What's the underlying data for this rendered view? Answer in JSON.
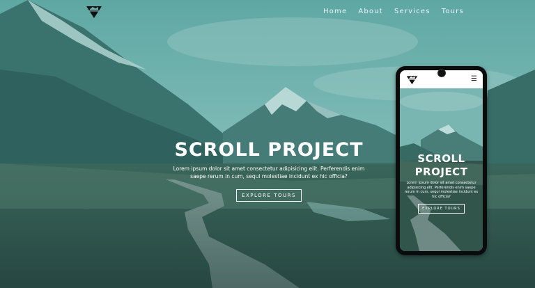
{
  "nav": {
    "logo_icon": "mountain-logo-icon",
    "links": [
      "Home",
      "About",
      "Services",
      "Tours"
    ]
  },
  "hero": {
    "title": "SCROLL PROJECT",
    "text": "Lorem ipsum dolor sit amet consectetur adipisicing elit. Perferendis enim saepe rerum in cum, sequi molestiae incidunt ex hic officia?",
    "button": "EXPLORE TOURS"
  },
  "phone": {
    "logo_icon": "mountain-logo-icon",
    "menu_icon": "☰",
    "title_line1": "SCROLL",
    "title_line2": "PROJECT",
    "text": "Lorem ipsum dolor sit amet consectetur adipisicing elit. Perferendis enim saepe rerum in cum, sequi molestiae incidunt ex hic officia?",
    "button": "EXPLORE TOURS"
  },
  "colors": {
    "overlay": "#2f8a88",
    "sky": "#8fc3c0",
    "text": "#ffffff"
  }
}
